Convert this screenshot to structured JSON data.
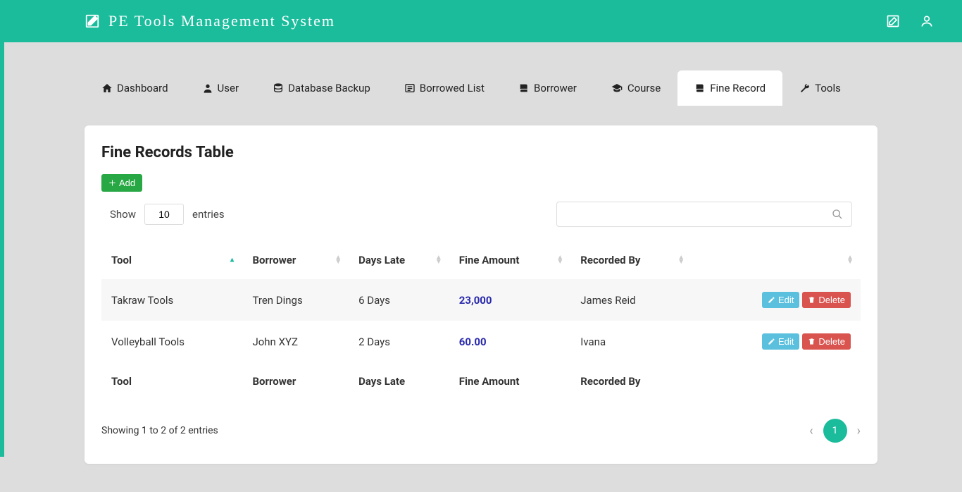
{
  "brand": {
    "title": "PE  Tools  Management  System"
  },
  "tabs": [
    {
      "label": "Dashboard",
      "icon": "home"
    },
    {
      "label": "User",
      "icon": "user"
    },
    {
      "label": "Database Backup",
      "icon": "database"
    },
    {
      "label": "Borrowed List",
      "icon": "list"
    },
    {
      "label": "Borrower",
      "icon": "book"
    },
    {
      "label": "Course",
      "icon": "grad"
    },
    {
      "label": "Fine Record",
      "icon": "book",
      "active": true
    },
    {
      "label": "Tools",
      "icon": "wrench"
    }
  ],
  "page": {
    "title": "Fine Records Table",
    "add_label": "Add",
    "show_label": "Show",
    "entries_value": "10",
    "entries_label": "entries",
    "search_value": ""
  },
  "table": {
    "headers": [
      "Tool",
      "Borrower",
      "Days Late",
      "Fine Amount",
      "Recorded By",
      ""
    ],
    "rows": [
      {
        "tool": "Takraw Tools",
        "borrower": "Tren Dings",
        "days_late": "6 Days",
        "fine": "23,000",
        "recorded_by": "James Reid"
      },
      {
        "tool": "Volleyball Tools",
        "borrower": "John XYZ",
        "days_late": "2 Days",
        "fine": "60.00",
        "recorded_by": "Ivana"
      }
    ],
    "footers": [
      "Tool",
      "Borrower",
      "Days Late",
      "Fine Amount",
      "Recorded By",
      ""
    ],
    "edit_label": "Edit",
    "delete_label": "Delete"
  },
  "footer": {
    "info": "Showing 1 to 2 of 2 entries",
    "page": "1"
  }
}
